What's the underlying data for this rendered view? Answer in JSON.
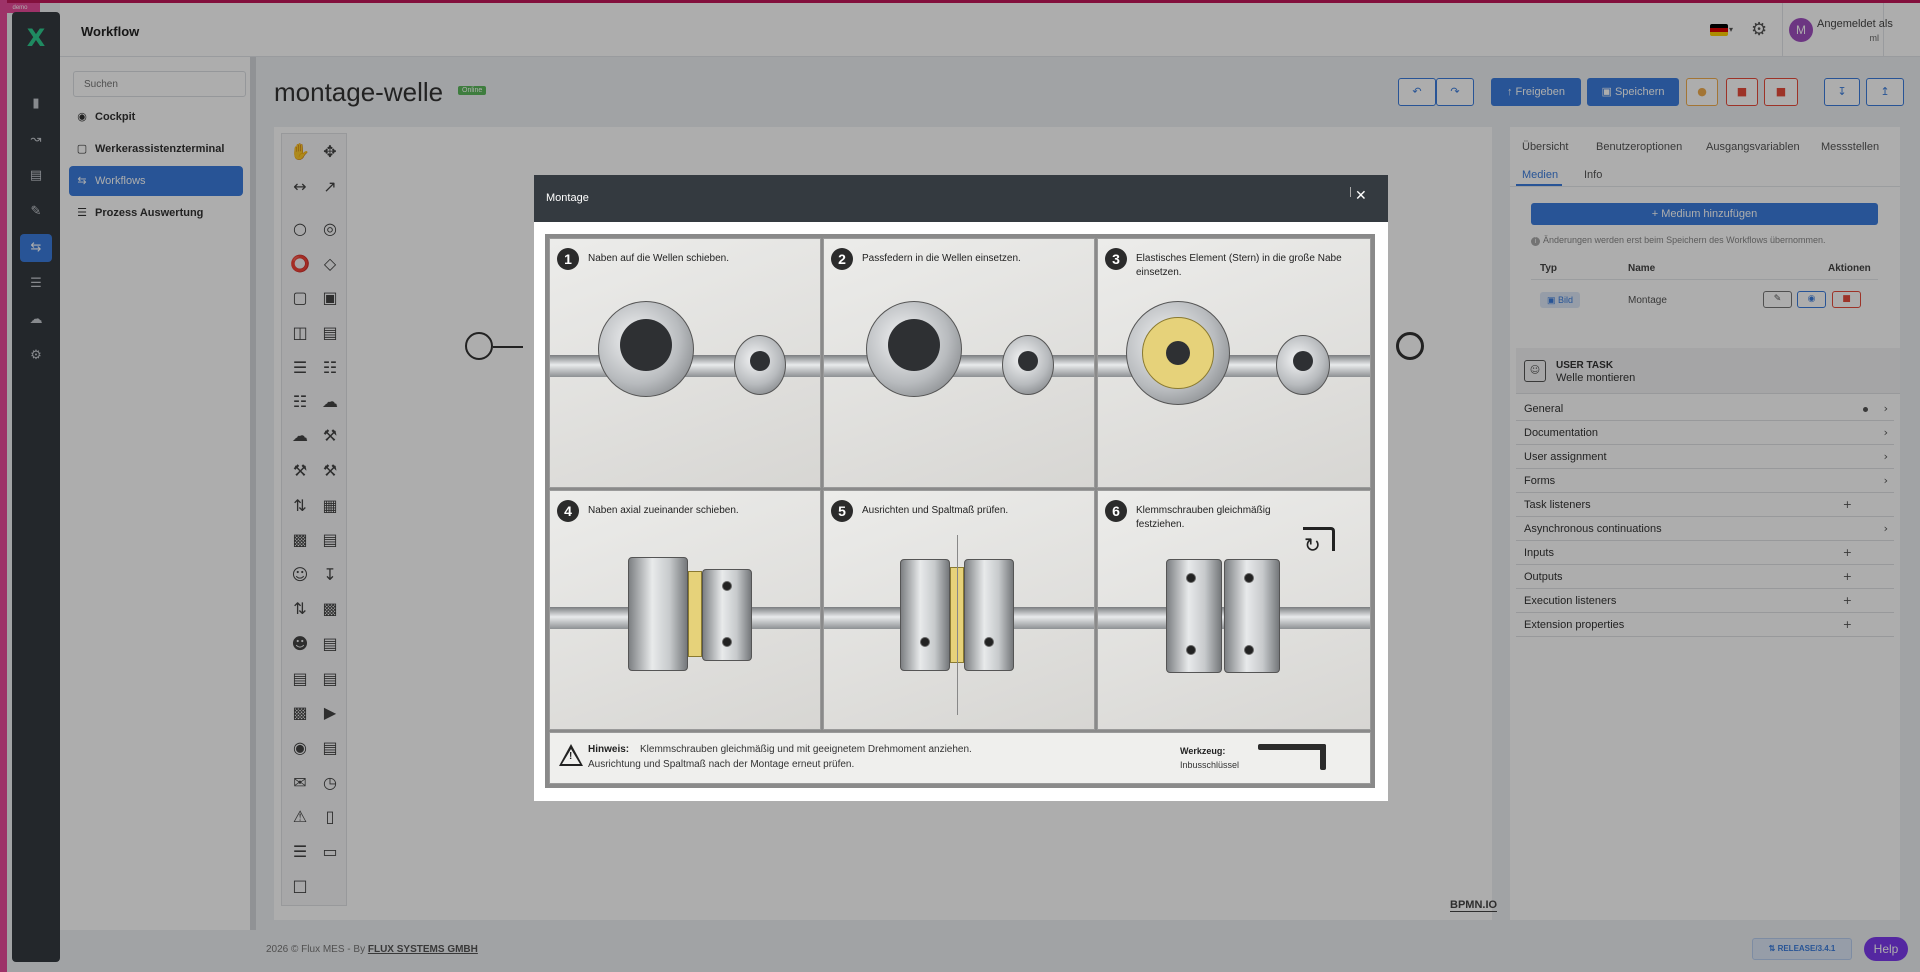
{
  "env": {
    "tag": "demo"
  },
  "header": {
    "title": "Workflow",
    "user_line1": "Angemeldet als",
    "user_line2": "ml",
    "avatar_initial": "M"
  },
  "rail": {
    "logo": "X",
    "icons": [
      "clipboard-icon",
      "chart-icon",
      "terminal-icon",
      "pencil-icon",
      "workflow-icon",
      "database-icon",
      "cloud-icon",
      "settings-icon"
    ]
  },
  "nav": {
    "search_placeholder": "Suchen",
    "items": [
      {
        "label": "Cockpit",
        "icon": "gauge-icon"
      },
      {
        "label": "Werkerassistenzterminal",
        "icon": "tablet-icon"
      },
      {
        "label": "Workflows",
        "icon": "workflow-icon"
      },
      {
        "label": "Prozess Auswertung",
        "icon": "list-icon"
      }
    ]
  },
  "main": {
    "title": "montage-welle",
    "status": "Online",
    "buttons": {
      "release": "Freigeben",
      "save": "Speichern"
    }
  },
  "canvas": {
    "watermark": "BPMN.IO"
  },
  "panel": {
    "tabs": [
      "Übersicht",
      "Benutzeroptionen",
      "Ausgangsvariablen",
      "Messstellen",
      "Medien",
      "Info"
    ],
    "add_medium": "Medium hinzufügen",
    "note": "Änderungen werden erst beim Speichern des Workflows übernommen.",
    "table": {
      "headers": [
        "Typ",
        "Name",
        "Aktionen"
      ],
      "rows": [
        {
          "type": "Bild",
          "name": "Montage"
        }
      ]
    },
    "task": {
      "kind": "USER TASK",
      "name": "Welle montieren"
    },
    "sections": [
      {
        "label": "General",
        "icon": "chevron-right-icon"
      },
      {
        "label": "Documentation",
        "icon": "chevron-right-icon"
      },
      {
        "label": "User assignment",
        "icon": "chevron-right-icon"
      },
      {
        "label": "Forms",
        "icon": "chevron-right-icon"
      },
      {
        "label": "Task listeners",
        "icon": "plus-icon"
      },
      {
        "label": "Asynchronous continuations",
        "icon": "chevron-right-icon"
      },
      {
        "label": "Inputs",
        "icon": "plus-icon"
      },
      {
        "label": "Outputs",
        "icon": "plus-icon"
      },
      {
        "label": "Execution listeners",
        "icon": "plus-icon"
      },
      {
        "label": "Extension properties",
        "icon": "plus-icon"
      }
    ]
  },
  "footer": {
    "text": "2026 © Flux MES - By",
    "company": "FLUX SYSTEMS GMBH",
    "release": "RELEASE/3.4.1",
    "help": "Help"
  },
  "modal": {
    "title": "Montage",
    "steps": [
      {
        "num": "1",
        "text": "Naben auf die Wellen schieben."
      },
      {
        "num": "2",
        "text": "Passfedern in die Wellen einsetzen."
      },
      {
        "num": "3",
        "text": "Elastisches Element (Stern) in die große Nabe einsetzen."
      },
      {
        "num": "4",
        "text": "Naben axial zueinander schieben."
      },
      {
        "num": "5",
        "text": "Ausrichten und Spaltmaß prüfen."
      },
      {
        "num": "6",
        "text": "Klemmschrauben gleichmäßig festziehen."
      }
    ],
    "hint_label": "Hinweis:",
    "hint_line1": "Klemmschrauben gleichmäßig und mit geeignetem Drehmoment anziehen.",
    "hint_line2": "Ausrichtung und Spaltmaß nach der Montage erneut prüfen.",
    "tool_label": "Werkzeug:",
    "tool_value": "Inbusschlüssel"
  }
}
